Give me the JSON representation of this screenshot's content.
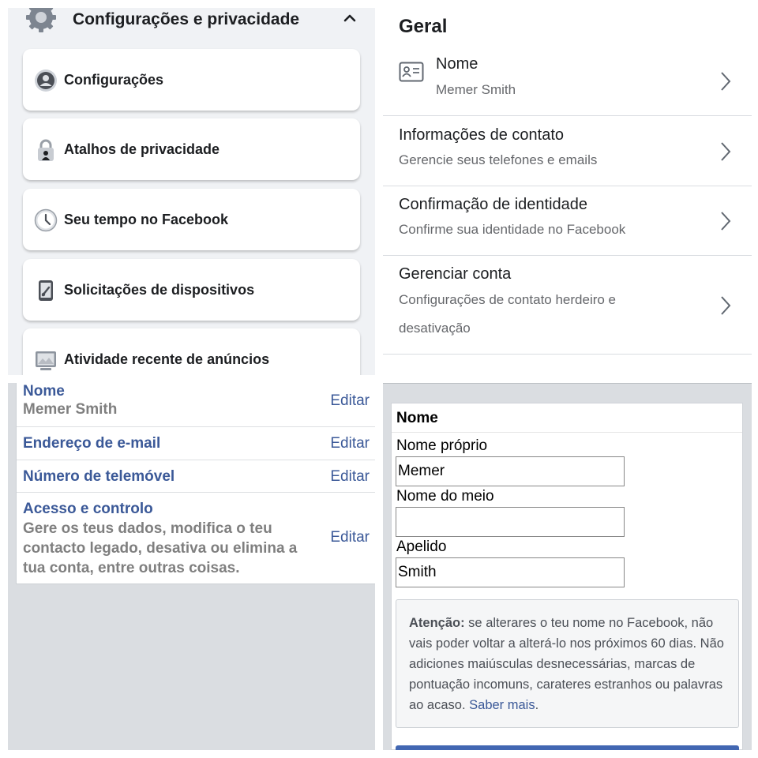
{
  "top_left": {
    "header_title": "Configurações e privacidade",
    "header_icon": "gear-icon",
    "items": [
      {
        "label": "Configurações",
        "icon": "profile-icon"
      },
      {
        "label": "Atalhos de privacidade",
        "icon": "lock-icon"
      },
      {
        "label": "Seu tempo no Facebook",
        "icon": "clock-icon"
      },
      {
        "label": "Solicitações de dispositivos",
        "icon": "device-icon"
      },
      {
        "label": "Atividade recente de anúncios",
        "icon": "ad-activity-icon"
      }
    ]
  },
  "top_right": {
    "section_title": "Geral",
    "rows": [
      {
        "title": "Nome",
        "subtitle": "Memer Smith"
      },
      {
        "title": "Informações de contato",
        "subtitle": "Gerencie seus telefones e emails"
      },
      {
        "title": "Confirmação de identidade",
        "subtitle": "Confirme sua identidade no Facebook"
      },
      {
        "title": "Gerenciar conta",
        "subtitle": "Configurações de contato herdeiro e desativação"
      }
    ]
  },
  "bottom_left": {
    "edit_label": "Editar",
    "rows": [
      {
        "title": "Nome",
        "subtitle": "Memer Smith"
      },
      {
        "title": "Endereço de e-mail",
        "subtitle": ""
      },
      {
        "title": "Número de telemóvel",
        "subtitle": ""
      },
      {
        "title": "Acesso e controlo",
        "subtitle": "Gere os teus dados, modifica o teu contacto legado, desativa ou elimina a tua conta, entre outras coisas."
      }
    ]
  },
  "bottom_right": {
    "card_title": "Nome",
    "first_name_label": "Nome próprio",
    "first_name_value": "Memer",
    "middle_name_label": "Nome do meio",
    "middle_name_value": "",
    "last_name_label": "Apelido",
    "last_name_value": "Smith",
    "warning_bold": "Atenção:",
    "warning_text": " se alterares o teu nome no Facebook, não vais poder voltar a alterá-lo nos próximos 60 dias. Não adiciones maiúsculas desnecessárias, marcas de pontuação incomuns, carateres estranhos ou palavras ao acaso. ",
    "learn_more": "Saber mais",
    "warning_end": "."
  },
  "colors": {
    "facebook_blue": "#3b5998",
    "button_blue": "#4267b2",
    "page_gray": "#f0f2f5",
    "secondary_text": "#65676b"
  }
}
